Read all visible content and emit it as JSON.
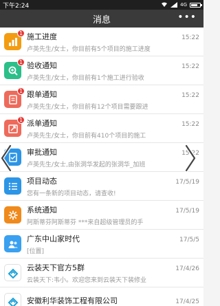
{
  "statusbar": {
    "time": "下午2:24",
    "signal": "4G",
    "battery_level": 0.75
  },
  "header": {
    "title": "消息",
    "more": "•••"
  },
  "rows": [
    {
      "title": "施工进度",
      "time": "15:22",
      "sub": "卢英先生/女士，你目前有5个项目的施工进度",
      "badge": "1",
      "color": "#f39c12",
      "icon": "bar-chart-icon"
    },
    {
      "title": "验收通知",
      "time": "15:22",
      "sub": "卢英先生/女士，你目前有1个施工进行验收",
      "badge": "1",
      "color": "#2bbf8a",
      "icon": "magnifier-icon"
    },
    {
      "title": "跟单通知",
      "time": "15:22",
      "sub": "卢英先生/女士，你目前有12个项目需要跟进",
      "badge": "1",
      "color": "#ee6a5b",
      "icon": "clipboard-icon"
    },
    {
      "title": "派单通知",
      "time": "15:22",
      "sub": "卢英先生/女士，你目前有410个项目的施工",
      "badge": "1",
      "color": "#ee6a5b",
      "icon": "dispatch-icon"
    },
    {
      "title": "审批通知",
      "time": "15:22",
      "sub": "卢英先生/女士,由张洞华发起的张洞华_加班",
      "badge": "",
      "color": "#2d95e6",
      "icon": "approval-icon"
    },
    {
      "title": "项目动态",
      "time": "17/5/19",
      "sub": "您有一条新的项目动态，请查收!",
      "badge": "",
      "color": "#2d95e6",
      "icon": "list-icon"
    },
    {
      "title": "系统通知",
      "time": "17/5/19",
      "sub": "阿斯蒂芬阿斯蒂芬 ***来自超级管理员的手",
      "badge": "",
      "color": "#f08a1c",
      "icon": "gear-icon"
    },
    {
      "title": "广东中山家时代",
      "time": "17/5/5",
      "sub": "[位置]",
      "badge": "",
      "color": "#3aa0f0",
      "icon": "group-avatar-icon"
    },
    {
      "title": "云装天下官方5群",
      "time": "17/4/26",
      "sub": "云装天下:韦小。欢迎您来到云装天下装修业",
      "badge": "",
      "color": "#ffffff",
      "icon": "brand-logo-icon"
    },
    {
      "title": "安徽利华装饰工程有限公司",
      "time": "17/4/25",
      "sub": "",
      "badge": "",
      "color": "#ffffff",
      "icon": "brand-logo-icon"
    }
  ]
}
